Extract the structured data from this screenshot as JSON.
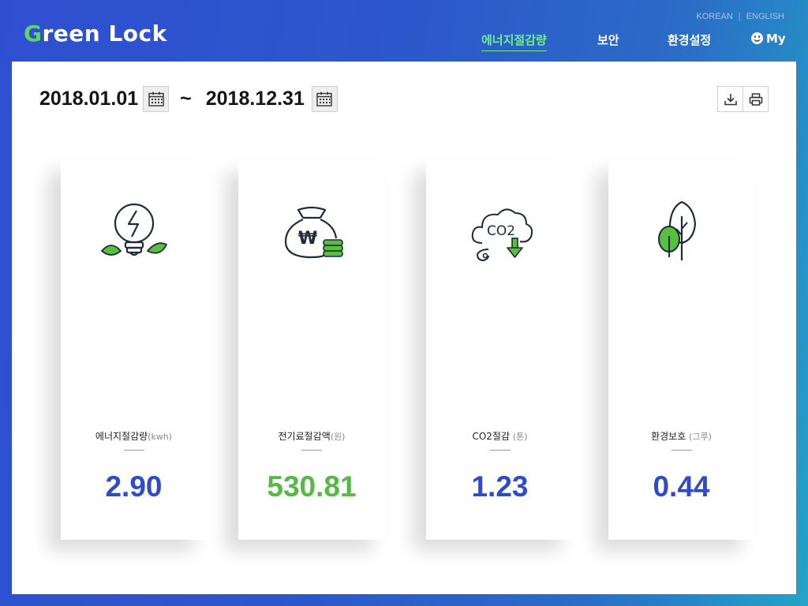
{
  "brand": {
    "logo_first": "G",
    "logo_rest": "reen Lock"
  },
  "language": {
    "korean": "KOREAN",
    "divider": "|",
    "english": "ENGLISH"
  },
  "nav": {
    "items": [
      {
        "label": "에너지절감량",
        "active": true
      },
      {
        "label": "보안",
        "active": false
      },
      {
        "label": "환경설정",
        "active": false
      },
      {
        "label": "My",
        "active": false,
        "icon": "smile-icon"
      }
    ]
  },
  "date_range": {
    "start": "2018.01.01",
    "separator": "~",
    "end": "2018.12.31"
  },
  "toolbar": {
    "download_icon": "download-icon",
    "print_icon": "print-icon"
  },
  "cards": [
    {
      "title": "에너지절감량",
      "unit": "(kwh)",
      "value": "2.90",
      "color": "#2f4bc7",
      "icon": "lightbulb-leaf-icon"
    },
    {
      "title": "전기료절감액",
      "unit": "(원)",
      "value": "530.81",
      "color": "#56b946",
      "icon": "money-bag-icon"
    },
    {
      "title": "CO2절감",
      "unit": "(톤)",
      "value": "1.23",
      "color": "#2f4bc7",
      "icon": "co2-cloud-icon"
    },
    {
      "title": "환경보호",
      "unit": "(그루)",
      "value": "0.44",
      "color": "#2f4bc7",
      "icon": "trees-icon"
    }
  ],
  "colors": {
    "accent_green": "#56b946",
    "accent_blue": "#2f4bc7",
    "nav_active": "#6ef08a"
  }
}
